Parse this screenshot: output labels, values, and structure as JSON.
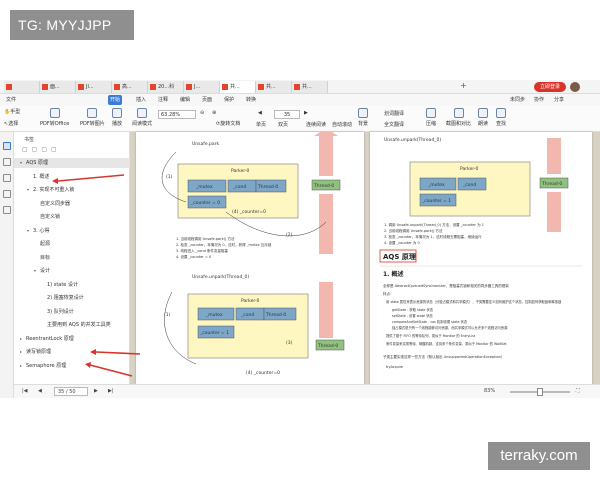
{
  "watermarks": {
    "tg": "TG: MYYJJPP",
    "site": "terraky.com"
  },
  "tabs": [
    {
      "label": "面..."
    },
    {
      "label": "Jl..."
    },
    {
      "label": "高..."
    },
    {
      "label": "20...科"
    },
    {
      "label": "J..."
    },
    {
      "label": "共..."
    },
    {
      "label": "共..."
    },
    {
      "label": "共..."
    }
  ],
  "login_label": "立即登录",
  "menu": {
    "file": "文件",
    "items": [
      "开始",
      "插入",
      "注释",
      "编辑",
      "页面",
      "保护",
      "转换"
    ],
    "right": [
      "未同步",
      "协作",
      "分享"
    ]
  },
  "toolbar": {
    "tools": [
      "手型",
      "选择",
      "PDF转Office",
      "PDF转图片",
      "播放",
      "阅读模式",
      "旋转文档",
      "单页",
      "双页",
      "连续阅读",
      "自动滚动",
      "背景",
      "全文翻译",
      "压缩",
      "截图和对比",
      "朗读",
      "查找"
    ],
    "zoom": "63.28%",
    "page": "35",
    "translate": "划词翻译"
  },
  "outline": {
    "head": "书签",
    "items": [
      {
        "label": "AQS 原理",
        "level": 0,
        "arrow": "▾",
        "selected": true
      },
      {
        "label": "1. 概述",
        "level": 1,
        "arrow": ""
      },
      {
        "label": "2. 实现不可重入锁",
        "level": 1,
        "arrow": "▾"
      },
      {
        "label": "自定义同步器",
        "level": 2,
        "arrow": ""
      },
      {
        "label": "自定义锁",
        "level": 2,
        "arrow": ""
      },
      {
        "label": "3. 心得",
        "level": 1,
        "arrow": "▾"
      },
      {
        "label": "起源",
        "level": 2,
        "arrow": ""
      },
      {
        "label": "目标",
        "level": 2,
        "arrow": ""
      },
      {
        "label": "设计",
        "level": 2,
        "arrow": "▾"
      },
      {
        "label": "1) state 设计",
        "level": 3,
        "arrow": ""
      },
      {
        "label": "2) 阻塞恢复设计",
        "level": 3,
        "arrow": ""
      },
      {
        "label": "3) 队列设计",
        "level": 3,
        "arrow": ""
      },
      {
        "label": "主要用到 AQS 的并发工具类",
        "level": 3,
        "arrow": ""
      },
      {
        "label": "ReentrantLock 原理",
        "level": 0,
        "arrow": "▸"
      },
      {
        "label": "读写锁原理",
        "level": 0,
        "arrow": "▸"
      },
      {
        "label": "Semaphore 原理",
        "level": 0,
        "arrow": "▸"
      }
    ]
  },
  "diagrams": {
    "unpark_label": "Unsafe.park",
    "unpark_thread_label": "Unsafe.unpark(Thread_0)",
    "parker": "Parker-0",
    "mutex": "_mutex",
    "cond": "_cond",
    "thread": "Thread-0",
    "counter0": "_counter = 0",
    "counter1": "_counter = 1",
    "step4": "(4) _counter=0",
    "n1": "(1)",
    "n2": "(2)",
    "n3": "(3)",
    "n4": "(4)",
    "n5": "(5)",
    "n6": "(6)"
  },
  "right_page": {
    "aqs_title": "AQS 原理",
    "overview": "1. 概述",
    "para1": "全称是 AbstractQueuedSynchronizer，是阻塞式锁和相关的同步器工具的框架",
    "features": "特点：",
    "bullet1": "用 state 属性来表示资源的状态（分独占模式和共享模式），子类需要定义如何维护这个状态，控制如何获取锁和释放锁",
    "sub1": "getState - 获取 state 状态",
    "sub2": "setState - 设置 state 状态",
    "sub3": "compareAndSetState - cas 机制设置 state 状态",
    "sub4": "独占模式是只有一个线程能够访问资源，而共享模式可以允许多个线程访问资源",
    "bullet2": "提供了基于 FIFO 的等待队列，类似于 Monitor 的 EntryList",
    "bullet3": "条件变量来实现等待、唤醒机制，支持多个条件变量，类似于 Monitor 的 WaitSet",
    "para2": "子类主要实现这样一些方法（默认抛出 UnsupportedOperationException）",
    "sub5": "tryAcquire"
  },
  "status": {
    "page": "35 / 50",
    "zoom": "83%"
  }
}
